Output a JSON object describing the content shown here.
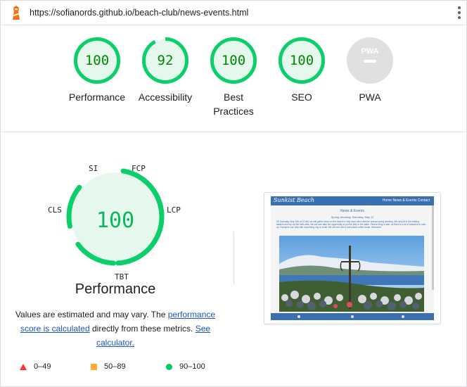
{
  "url_bar": {
    "url": "https://sofianords.github.io/beach-club/news-events.html",
    "logo_icon": "lighthouse-icon",
    "menu_icon": "kebab-menu-icon"
  },
  "gauges": [
    {
      "score": "100",
      "label": "Performance",
      "value": 100,
      "rating": "pass"
    },
    {
      "score": "92",
      "label": "Accessibility",
      "value": 92,
      "rating": "pass"
    },
    {
      "score": "100",
      "label": "Best Practices",
      "value": 100,
      "rating": "pass"
    },
    {
      "score": "100",
      "label": "SEO",
      "value": 100,
      "rating": "pass"
    },
    {
      "score": "PWA",
      "label": "PWA",
      "rating": "na"
    }
  ],
  "performance": {
    "score": "100",
    "title": "Performance",
    "metrics": [
      "SI",
      "FCP",
      "LCP",
      "TBT",
      "CLS"
    ],
    "note": {
      "text_1": "Values are estimated and may vary. The ",
      "link_1": "performance score is calculated",
      "text_2": " directly from these metrics. ",
      "link_2": "See calculator."
    }
  },
  "screenshot": {
    "brand": "Sunkist Beach",
    "nav_links": "Home  News & Events  Contact",
    "heading": "News & Events",
    "subheading": "Spring cleaning: Saturday, May 11",
    "paragraph": "On Saturday, May 11th at 10 AM, we will gather down on the beach to help each other with the annual spring cleaning. We will put in the bathing ladders and lay out the bath rafts. We will also take the opportunity to put the jetty in the water. Please bring a rake, as there is a lot of seaweed to rake up. Everyone can help with something, big or small. We will end with a communal coffee break. Welcome!"
  },
  "legend": [
    {
      "shape": "triangle",
      "range": "0–49",
      "color": "#ff3333"
    },
    {
      "shape": "square",
      "range": "50–89",
      "color": "#ffaa33"
    },
    {
      "shape": "circle",
      "range": "90–100",
      "color": "#00cc66"
    }
  ],
  "colors": {
    "pass": "#0cce6b",
    "pass_bg": "#e6f8ee",
    "pass_text": "#008800",
    "na": "#e0e0e0",
    "link": "#1a55c9"
  }
}
